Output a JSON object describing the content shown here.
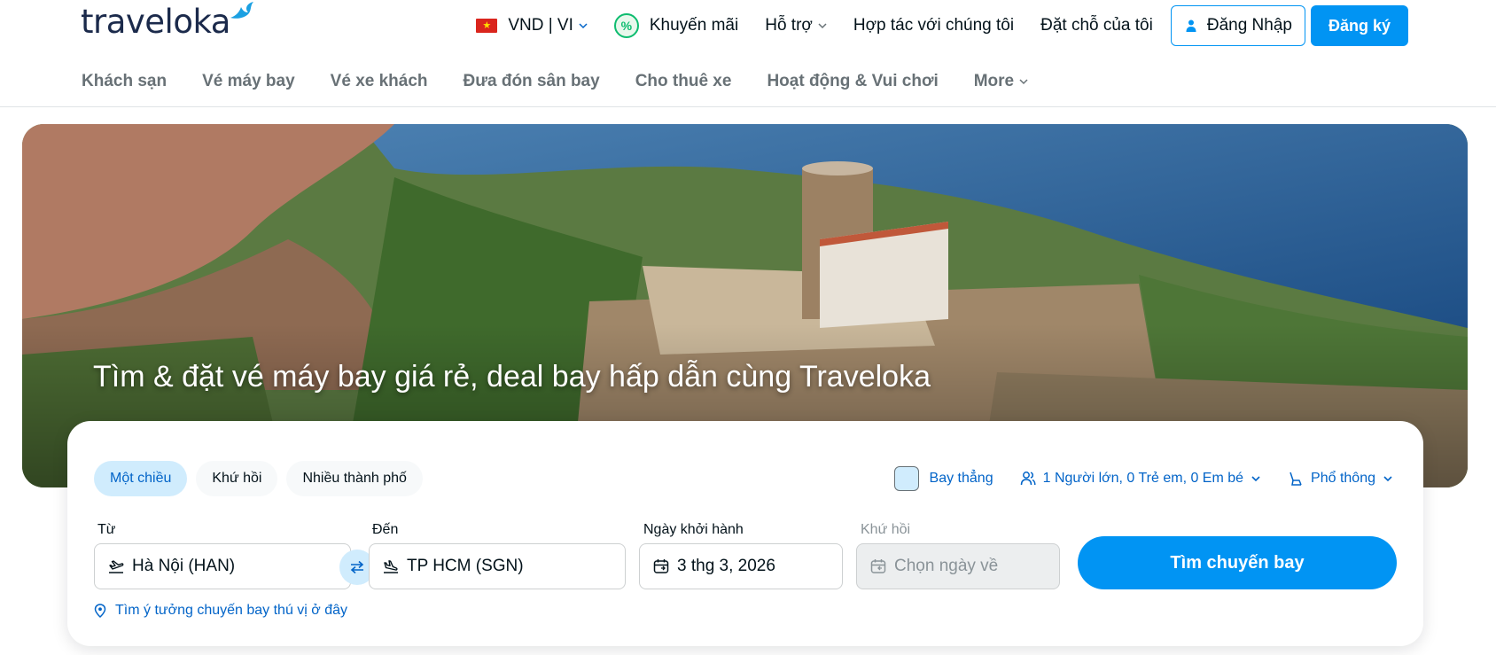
{
  "header": {
    "logo": "traveloka",
    "currency_lang": "VND | VI",
    "promotions": "Khuyến mãi",
    "support": "Hỗ trợ",
    "partner": "Hợp tác với chúng tôi",
    "my_bookings": "Đặt chỗ của tôi",
    "login": "Đăng Nhập",
    "register": "Đăng ký"
  },
  "subnav": {
    "items": [
      "Khách sạn",
      "Vé máy bay",
      "Vé xe khách",
      "Đưa đón sân bay",
      "Cho thuê xe",
      "Hoạt động & Vui chơi",
      "More"
    ]
  },
  "hero": {
    "title": "Tìm & đặt vé máy bay giá rẻ, deal bay hấp dẫn cùng Traveloka"
  },
  "search": {
    "trip_types": [
      "Một chiều",
      "Khứ hồi",
      "Nhiều thành phố"
    ],
    "active_trip_type": "Một chiều",
    "direct_label": "Bay thẳng",
    "passengers": "1 Người lớn, 0 Trẻ em, 0 Em bé",
    "cabin": "Phổ thông",
    "from_label": "Từ",
    "from_value": "Hà Nội (HAN)",
    "to_label": "Đến",
    "to_value": "TP HCM (SGN)",
    "depart_label": "Ngày khởi hành",
    "depart_value": "3 thg 3, 2026",
    "return_label": "Khứ hồi",
    "return_placeholder": "Chọn ngày về",
    "search_button": "Tìm chuyến bay",
    "ideas_link": "Tìm ý tưởng chuyến bay thú vị ở đây"
  },
  "colors": {
    "brand_blue": "#0194f3",
    "active_tab_bg": "#d0ecfd",
    "link_blue": "#0264c8",
    "promo_green": "#0dbc6f"
  }
}
